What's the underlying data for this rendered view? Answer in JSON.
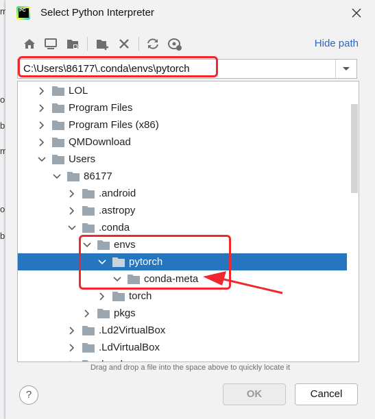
{
  "background_fragments": [
    "m",
    "ol",
    "b",
    "mi",
    "ol",
    "b"
  ],
  "dialog": {
    "title": "Select Python Interpreter",
    "app_icon_text": "PC",
    "hide_path_label": "Hide path",
    "path_value": "C:\\Users\\86177\\.conda\\envs\\pytorch",
    "hint": "Drag and drop a file into the space above to quickly locate it",
    "ok_label": "OK",
    "cancel_label": "Cancel",
    "help_label": "?"
  },
  "toolbar": {
    "buttons": [
      "home-icon",
      "desktop-icon",
      "project-folder-icon",
      "new-folder-icon",
      "delete-icon",
      "refresh-icon",
      "show-hidden-icon"
    ]
  },
  "tree": {
    "rows": [
      {
        "label": "LOL",
        "depth": 1,
        "state": "collapsed"
      },
      {
        "label": "Program Files",
        "depth": 1,
        "state": "collapsed"
      },
      {
        "label": "Program Files (x86)",
        "depth": 1,
        "state": "collapsed"
      },
      {
        "label": "QMDownload",
        "depth": 1,
        "state": "collapsed"
      },
      {
        "label": "Users",
        "depth": 1,
        "state": "expanded"
      },
      {
        "label": "86177",
        "depth": 2,
        "state": "expanded"
      },
      {
        "label": ".android",
        "depth": 3,
        "state": "collapsed"
      },
      {
        "label": ".astropy",
        "depth": 3,
        "state": "collapsed"
      },
      {
        "label": ".conda",
        "depth": 3,
        "state": "expanded"
      },
      {
        "label": "envs",
        "depth": 4,
        "state": "expanded"
      },
      {
        "label": "pytorch",
        "depth": 5,
        "state": "expanded",
        "selected": true
      },
      {
        "label": "conda-meta",
        "depth": 6,
        "state": "expanded"
      },
      {
        "label": "torch",
        "depth": 5,
        "state": "collapsed"
      },
      {
        "label": "pkgs",
        "depth": 4,
        "state": "collapsed"
      },
      {
        "label": ".Ld2VirtualBox",
        "depth": 3,
        "state": "collapsed"
      },
      {
        "label": ".LdVirtualBox",
        "depth": 3,
        "state": "collapsed"
      },
      {
        "label": ".local",
        "depth": 3,
        "state": "collapsed"
      }
    ]
  },
  "colors": {
    "selection": "#2675bf",
    "annotation_red": "#f0272c",
    "folder": "#9aa7b0",
    "link": "#2f66c4"
  }
}
